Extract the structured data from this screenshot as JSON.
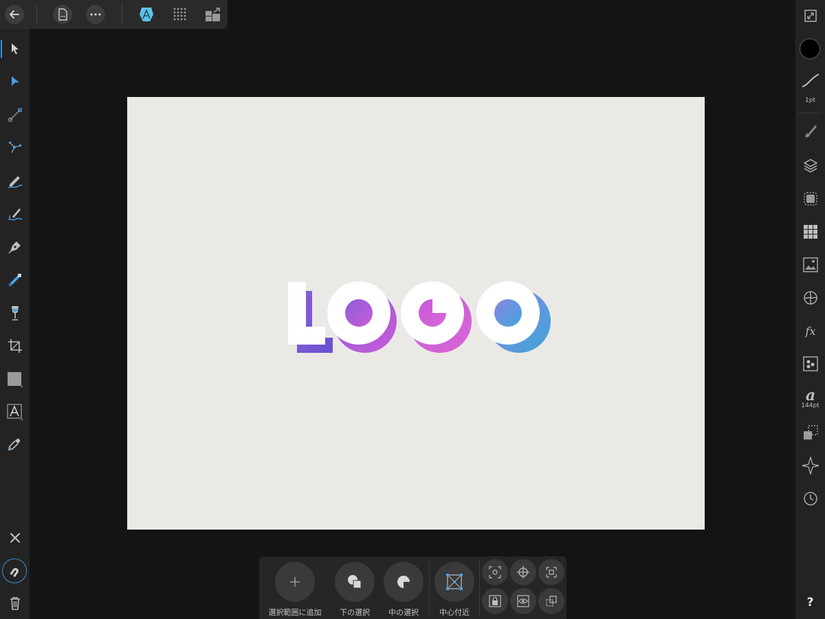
{
  "top_toolbar": {
    "items": [
      "back-icon",
      "document-icon",
      "more-icon",
      "designer-persona-icon",
      "pixel-persona-icon",
      "export-persona-icon"
    ]
  },
  "left_tools": {
    "items": [
      "move-tool",
      "node-tool",
      "point-transform-tool",
      "contour-tool",
      "pencil-tool",
      "vector-brush-tool",
      "pen-tool",
      "fill-tool",
      "transparency-tool",
      "crop-tool",
      "rectangle-tool",
      "artistic-text-tool",
      "color-picker-tool"
    ],
    "bottom": [
      "close-icon",
      "snapping-icon",
      "trash-icon"
    ]
  },
  "right_panel": {
    "stroke_width": "1pt",
    "font_size": "144pt",
    "help": "?"
  },
  "canvas": {
    "logo_text": [
      "L",
      "O",
      "G",
      "O"
    ],
    "accent_gradient": [
      "#6a4fd0",
      "#c05ad8",
      "#d45fd8",
      "#4aa3da"
    ],
    "front_color": "#ffffff"
  },
  "context_bar": {
    "buttons": [
      {
        "label": "選択範囲に追加",
        "icon": "plus-icon"
      },
      {
        "label": "下の選択",
        "icon": "select-under-icon"
      },
      {
        "label": "中の選択",
        "icon": "select-inside-icon"
      },
      {
        "label": "中心付近",
        "icon": "transform-origin-icon"
      }
    ],
    "small_buttons": [
      "alignment-snap-icon",
      "crosshair-icon",
      "distribute-icon",
      "lock-frame-icon",
      "view-icon",
      "duplicate-icon"
    ]
  },
  "colors": {
    "background": "#141414",
    "panel": "#232323",
    "accent": "#3d8fd8",
    "artboard": "#ebe9e6"
  }
}
